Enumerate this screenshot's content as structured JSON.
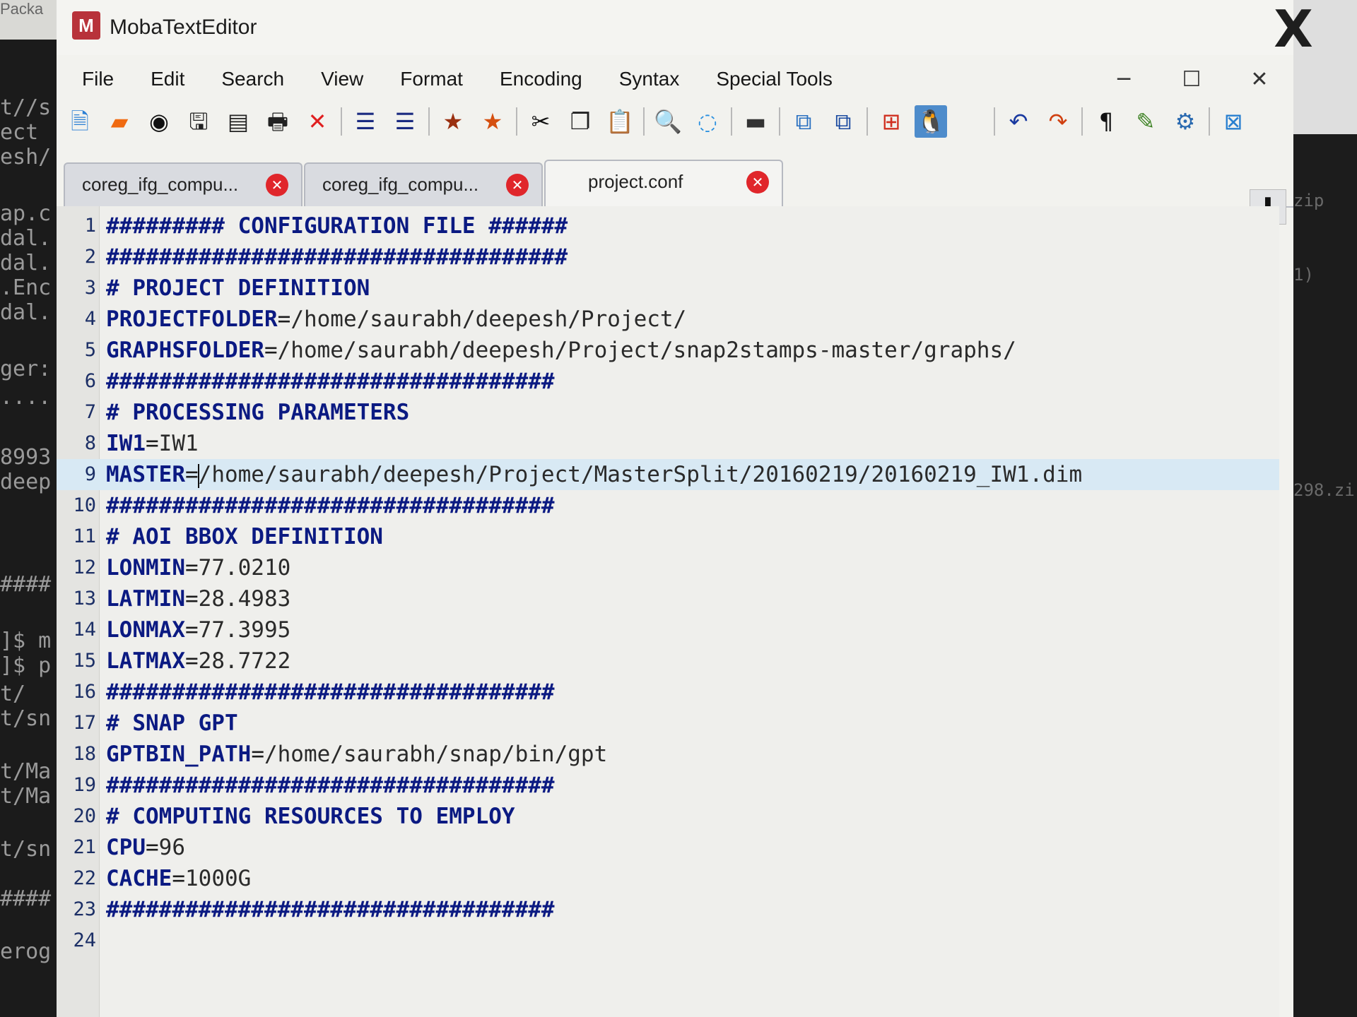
{
  "window": {
    "title": "MobaTextEditor"
  },
  "window_controls": {
    "minimize": "─",
    "maximize": "☐",
    "close": "✕"
  },
  "outer_close": "X",
  "menu": [
    "File",
    "Edit",
    "Search",
    "View",
    "Format",
    "Encoding",
    "Syntax",
    "Special Tools"
  ],
  "toolbar": [
    {
      "name": "new-file-icon",
      "glyph": "🗎",
      "color": "#2a7fd4"
    },
    {
      "name": "open-folder-icon",
      "glyph": "▰",
      "color": "#f06a10"
    },
    {
      "name": "reload-icon",
      "glyph": "◉",
      "color": "#111111"
    },
    {
      "name": "save-icon",
      "glyph": "🖫",
      "color": "#222222"
    },
    {
      "name": "save-all-icon",
      "glyph": "▤",
      "color": "#222222"
    },
    {
      "name": "print-icon",
      "glyph": "🖶",
      "color": "#222222"
    },
    {
      "name": "close-file-icon",
      "glyph": "✕",
      "color": "#e02020"
    },
    {
      "name": "indent-icon",
      "glyph": "☰",
      "color": "#1a2a80"
    },
    {
      "name": "unindent-icon",
      "glyph": "☰",
      "color": "#1a2a80"
    },
    {
      "name": "bookmark-icon",
      "glyph": "★",
      "color": "#9a3010"
    },
    {
      "name": "bookmark-next-icon",
      "glyph": "★",
      "color": "#d55010"
    },
    {
      "name": "cut-icon",
      "glyph": "✂",
      "color": "#111111"
    },
    {
      "name": "copy-icon",
      "glyph": "❐",
      "color": "#222222"
    },
    {
      "name": "paste-icon",
      "glyph": "📋",
      "color": "#1a4aa0"
    },
    {
      "name": "find-icon",
      "glyph": "🔍",
      "color": "#1a3aa0"
    },
    {
      "name": "find-replace-icon",
      "glyph": "◌",
      "color": "#2a90e0"
    },
    {
      "name": "terminal-icon",
      "glyph": "▬",
      "color": "#333333"
    },
    {
      "name": "compare-icon",
      "glyph": "⧉",
      "color": "#2a70c0"
    },
    {
      "name": "sync-icon",
      "glyph": "⧉",
      "color": "#1a4aa0"
    },
    {
      "name": "windows-format-icon",
      "glyph": "⊞",
      "color": "#d03020"
    },
    {
      "name": "linux-format-icon",
      "glyph": "🐧",
      "color": "#111111"
    },
    {
      "name": "mac-format-icon",
      "glyph": "",
      "color": "#2a5ab0"
    },
    {
      "name": "undo-icon",
      "glyph": "↶",
      "color": "#1a3aa0"
    },
    {
      "name": "redo-icon",
      "glyph": "↷",
      "color": "#d04010"
    },
    {
      "name": "pilcrow-icon",
      "glyph": "¶",
      "color": "#111111"
    },
    {
      "name": "pen-icon",
      "glyph": "✎",
      "color": "#3a8020"
    },
    {
      "name": "settings-icon",
      "glyph": "⚙",
      "color": "#2a6ab0"
    },
    {
      "name": "close-panel-icon",
      "glyph": "⊠",
      "color": "#2a80d0"
    }
  ],
  "tabs": [
    {
      "label": "coreg_ifg_compu...",
      "active": false
    },
    {
      "label": "coreg_ifg_compu...",
      "active": false
    },
    {
      "label": "project.conf",
      "active": true
    }
  ],
  "tab_close_glyph": "✕",
  "scroll_down_glyph": "⬇",
  "current_line": 9,
  "lines": [
    {
      "num": "1",
      "key": "######### CONFIGURATION FILE ######",
      "op": "",
      "val": ""
    },
    {
      "num": "2",
      "key": "###################################",
      "op": "",
      "val": ""
    },
    {
      "num": "3",
      "key": "# PROJECT DEFINITION",
      "op": "",
      "val": ""
    },
    {
      "num": "4",
      "key": "PROJECTFOLDER",
      "op": "=",
      "val": "/home/saurabh/deepesh/Project/"
    },
    {
      "num": "5",
      "key": "GRAPHSFOLDER",
      "op": "=",
      "val": "/home/saurabh/deepesh/Project/snap2stamps-master/graphs/"
    },
    {
      "num": "6",
      "key": "##################################",
      "op": "",
      "val": ""
    },
    {
      "num": "7",
      "key": "# PROCESSING PARAMETERS",
      "op": "",
      "val": ""
    },
    {
      "num": "8",
      "key": "IW1",
      "op": "=",
      "val": "IW1"
    },
    {
      "num": "9",
      "key": "MASTER",
      "op": "=",
      "val": "/home/saurabh/deepesh/Project/MasterSplit/20160219/20160219_IW1.dim"
    },
    {
      "num": "10",
      "key": "##################################",
      "op": "",
      "val": ""
    },
    {
      "num": "11",
      "key": "# AOI BBOX DEFINITION",
      "op": "",
      "val": ""
    },
    {
      "num": "12",
      "key": "LONMIN",
      "op": "=",
      "val": "77.0210"
    },
    {
      "num": "13",
      "key": "LATMIN",
      "op": "=",
      "val": "28.4983"
    },
    {
      "num": "14",
      "key": "LONMAX",
      "op": "=",
      "val": "77.3995"
    },
    {
      "num": "15",
      "key": "LATMAX",
      "op": "=",
      "val": "28.7722"
    },
    {
      "num": "16",
      "key": "##################################",
      "op": "",
      "val": ""
    },
    {
      "num": "17",
      "key": "# SNAP GPT",
      "op": "",
      "val": ""
    },
    {
      "num": "18",
      "key": "GPTBIN_PATH",
      "op": "=",
      "val": "/home/saurabh/snap/bin/gpt"
    },
    {
      "num": "19",
      "key": "##################################",
      "op": "",
      "val": ""
    },
    {
      "num": "20",
      "key": "# COMPUTING RESOURCES TO EMPLOY",
      "op": "",
      "val": ""
    },
    {
      "num": "21",
      "key": "CPU",
      "op": "=",
      "val": "96"
    },
    {
      "num": "22",
      "key": "CACHE",
      "op": "=",
      "val": "1000G"
    },
    {
      "num": "23",
      "key": "##################################",
      "op": "",
      "val": ""
    },
    {
      "num": "24",
      "key": "",
      "op": "",
      "val": ""
    }
  ],
  "terminal_left": {
    "top_label": "Packa",
    "lines": [
      "t//s",
      "ect",
      "esh/",
      "ap.c",
      "dal.",
      "dal.",
      ".Enc",
      "dal.",
      "ger:",
      "....",
      "8993",
      "deep",
      "####",
      "]$ m",
      "]$ p",
      "t/",
      "t/sn",
      "t/Ma",
      "t/Ma",
      "t/sn",
      "####",
      "erog"
    ]
  },
  "terminal_right": {
    "lines": [
      "zip",
      "1)",
      "298.zi"
    ]
  }
}
